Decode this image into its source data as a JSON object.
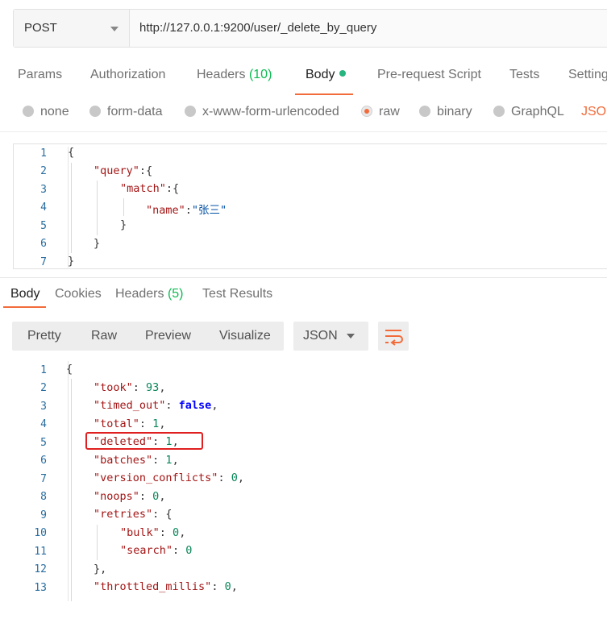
{
  "request": {
    "method": "POST",
    "url": "http://127.0.0.1:9200/user/_delete_by_query"
  },
  "request_tabs": {
    "params": "Params",
    "authorization": "Authorization",
    "headers": "Headers",
    "headers_count": "(10)",
    "body": "Body",
    "pre_request": "Pre-request Script",
    "tests": "Tests",
    "settings": "Setting"
  },
  "body_types": {
    "none": "none",
    "form_data": "form-data",
    "urlencoded": "x-www-form-urlencoded",
    "raw": "raw",
    "binary": "binary",
    "graphql": "GraphQL",
    "json": "JSON",
    "selected": "raw"
  },
  "request_body": {
    "line_numbers": [
      "1",
      "2",
      "3",
      "4",
      "5",
      "6",
      "7"
    ],
    "l1": "{",
    "l2_key": "\"query\"",
    "l2_rest": ":{",
    "l3_key": "\"match\"",
    "l3_rest": ":{",
    "l4_key": "\"name\"",
    "l4_sep": ":",
    "l4_val": "\"张三\"",
    "l5": "}",
    "l6": "}",
    "l7": "}"
  },
  "response_tabs": {
    "body": "Body",
    "cookies": "Cookies",
    "headers": "Headers",
    "headers_count": "(5)",
    "test_results": "Test Results"
  },
  "response_view": {
    "pretty": "Pretty",
    "raw": "Raw",
    "preview": "Preview",
    "visualize": "Visualize",
    "format": "JSON"
  },
  "response_body": {
    "line_numbers": [
      "1",
      "2",
      "3",
      "4",
      "5",
      "6",
      "7",
      "8",
      "9",
      "10",
      "11",
      "12",
      "13"
    ],
    "l1": "{",
    "took_key": "\"took\"",
    "took_val": "93",
    "timed_out_key": "\"timed_out\"",
    "timed_out_val": "false",
    "total_key": "\"total\"",
    "total_val": "1",
    "deleted_key": "\"deleted\"",
    "deleted_val": "1",
    "batches_key": "\"batches\"",
    "batches_val": "1",
    "version_conflicts_key": "\"version_conflicts\"",
    "version_conflicts_val": "0",
    "noops_key": "\"noops\"",
    "noops_val": "0",
    "retries_key": "\"retries\"",
    "retries_open": "{",
    "bulk_key": "\"bulk\"",
    "bulk_val": "0",
    "search_key": "\"search\"",
    "search_val": "0",
    "retries_close": "},",
    "throttled_key": "\"throttled_millis\"",
    "throttled_val": "0"
  },
  "colors": {
    "accent": "#f26b3a",
    "highlight_box": "#e02020",
    "body_dot": "#26b47f"
  }
}
